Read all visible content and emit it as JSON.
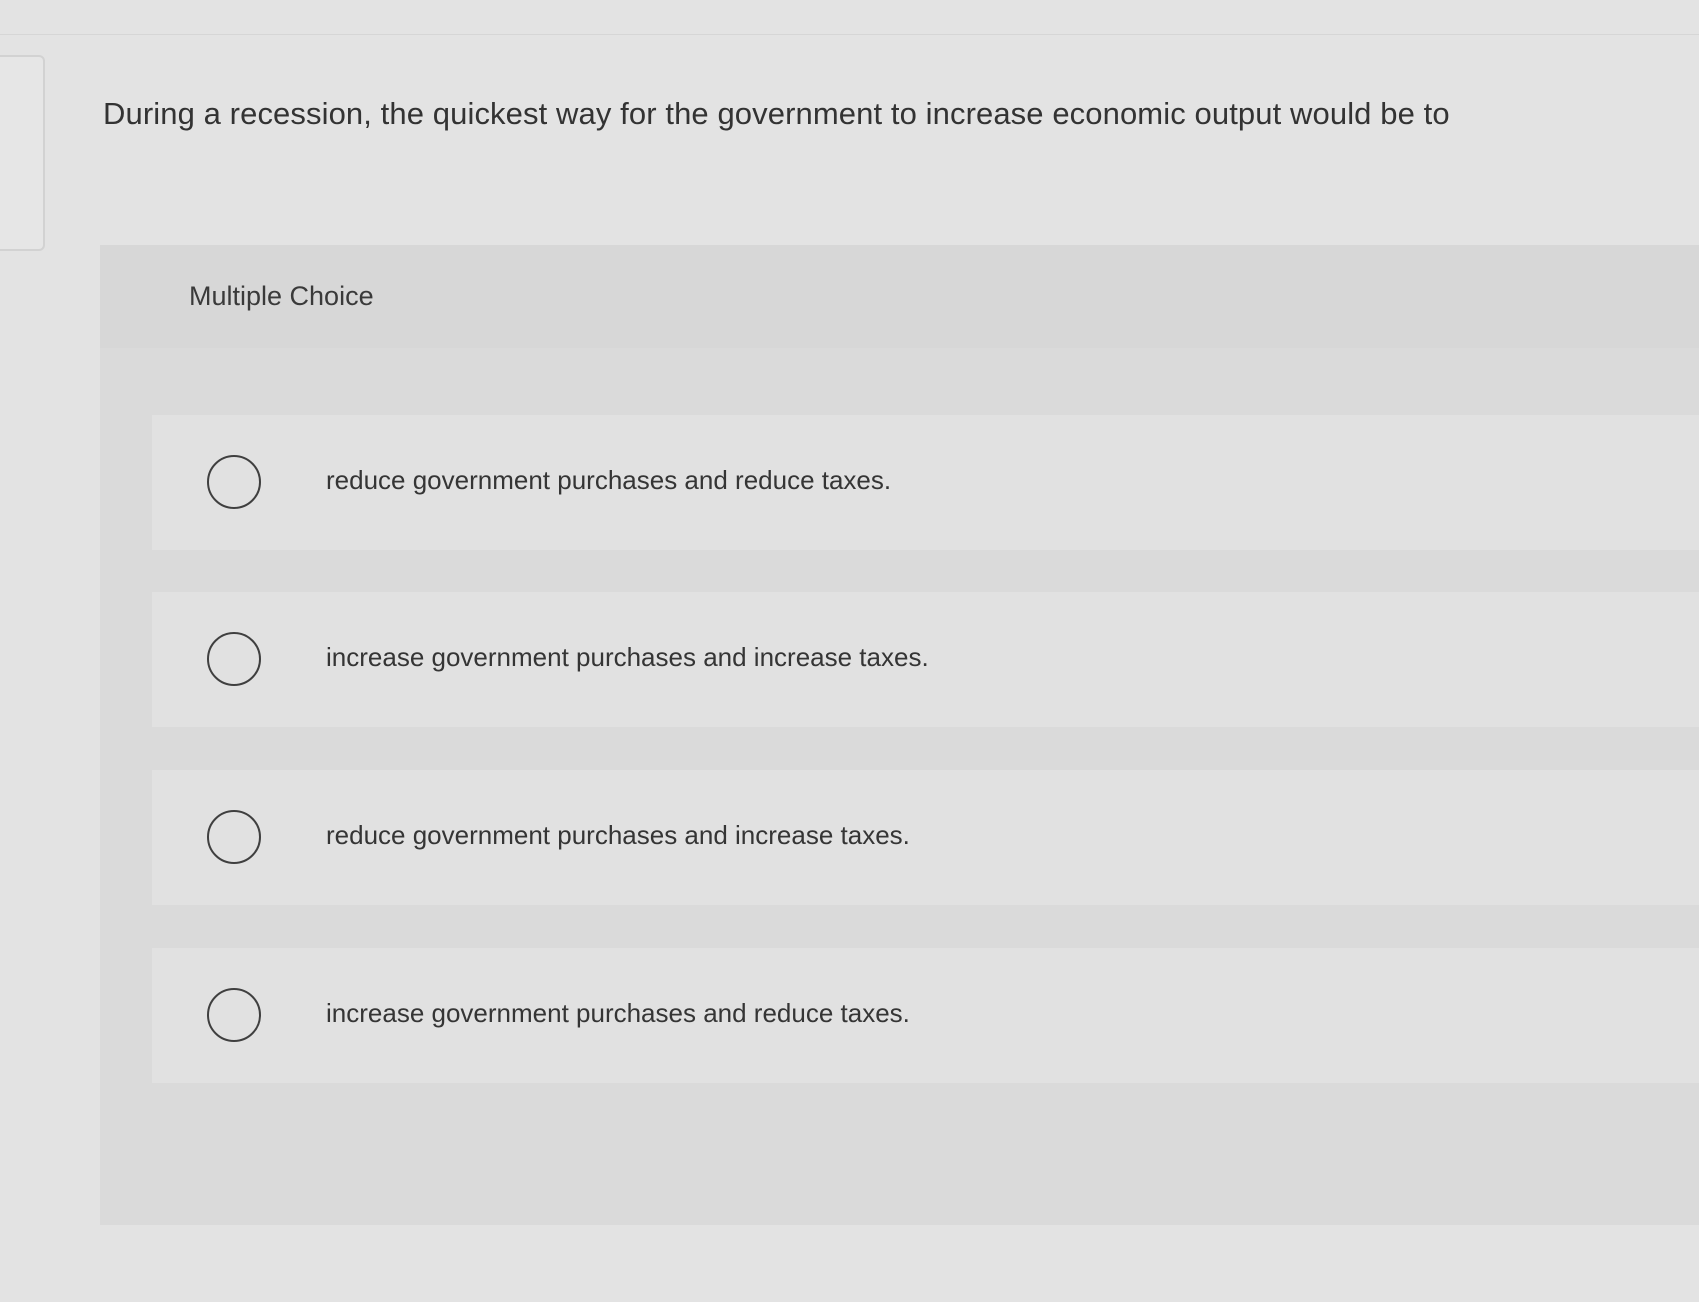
{
  "question": {
    "text": "During a recession, the quickest way for the government to increase economic output would be to"
  },
  "multiple_choice": {
    "label": "Multiple Choice",
    "options": [
      {
        "text": "reduce government purchases and reduce taxes.",
        "selected": false
      },
      {
        "text": "increase government purchases and increase taxes.",
        "selected": false
      },
      {
        "text": "reduce government purchases and increase taxes.",
        "selected": false
      },
      {
        "text": "increase government purchases and reduce taxes.",
        "selected": false
      }
    ]
  },
  "colors": {
    "background": "#e3e3e3",
    "panel": "#dadada",
    "option_row": "#e1e1e1",
    "text": "#333333",
    "radio_border": "#3f3f3f"
  },
  "icons": {
    "radio": "radio-unchecked-icon"
  }
}
